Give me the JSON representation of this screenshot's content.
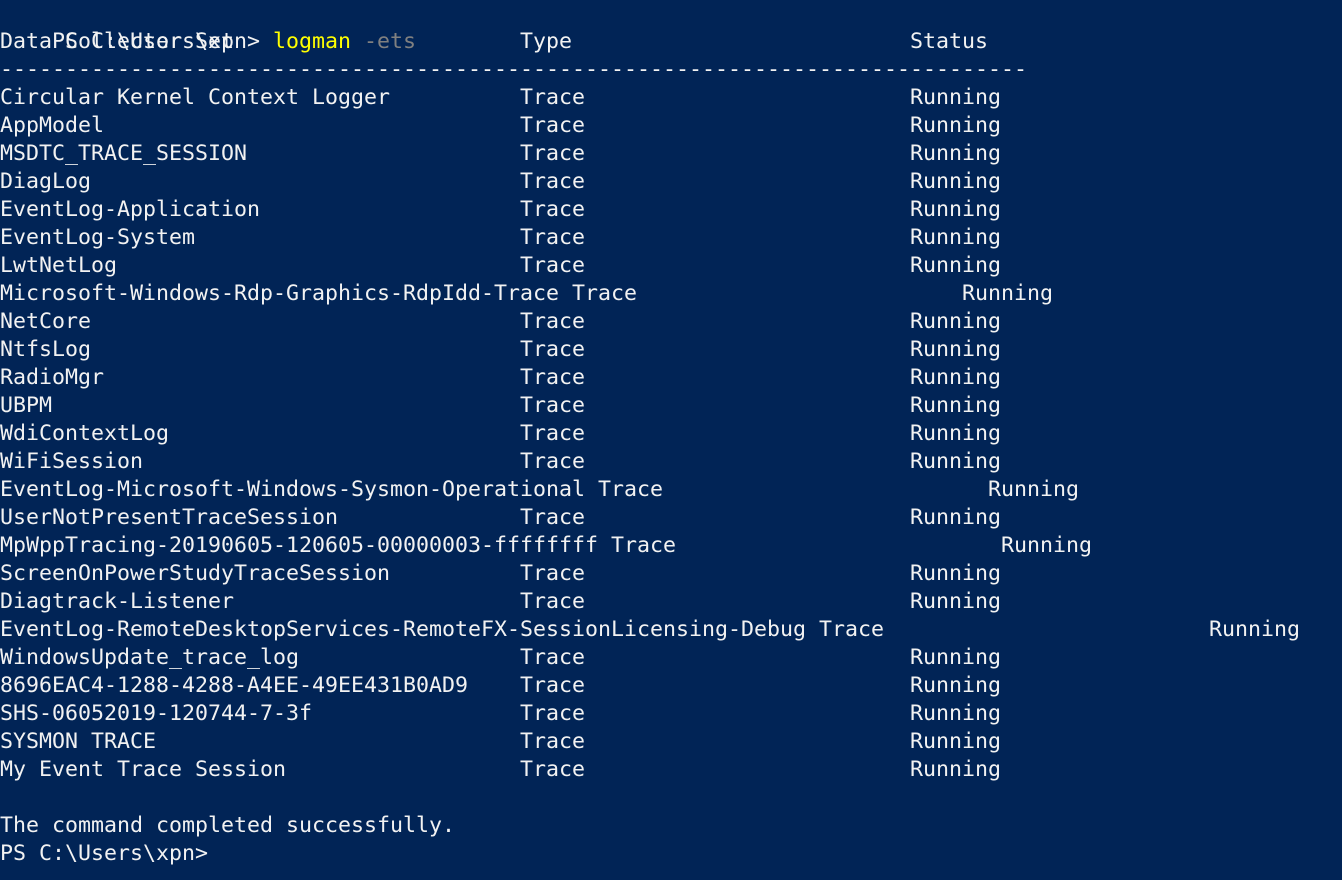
{
  "colors": {
    "background": "#012456",
    "foreground": "#f2f2f2",
    "command": "#ffff00",
    "parameter": "#808080"
  },
  "prompt_top": {
    "prompt": "PS C:\\Users\\xpn> ",
    "command": "logman",
    "parameter": " -ets"
  },
  "headers": {
    "name": "Data Collector Set",
    "type": "Type",
    "status": "Status"
  },
  "separator": "-------------------------------------------------------------------------------",
  "rows": [
    {
      "name": "Circular Kernel Context Logger",
      "type": "Trace",
      "status": "Running"
    },
    {
      "name": "AppModel",
      "type": "Trace",
      "status": "Running"
    },
    {
      "name": "MSDTC_TRACE_SESSION",
      "type": "Trace",
      "status": "Running"
    },
    {
      "name": "DiagLog",
      "type": "Trace",
      "status": "Running"
    },
    {
      "name": "EventLog-Application",
      "type": "Trace",
      "status": "Running"
    },
    {
      "name": "EventLog-System",
      "type": "Trace",
      "status": "Running"
    },
    {
      "name": "LwtNetLog",
      "type": "Trace",
      "status": "Running"
    },
    {
      "name": "Microsoft-Windows-Rdp-Graphics-RdpIdd-Trace",
      "type": "Trace",
      "status": "Running"
    },
    {
      "name": "NetCore",
      "type": "Trace",
      "status": "Running"
    },
    {
      "name": "NtfsLog",
      "type": "Trace",
      "status": "Running"
    },
    {
      "name": "RadioMgr",
      "type": "Trace",
      "status": "Running"
    },
    {
      "name": "UBPM",
      "type": "Trace",
      "status": "Running"
    },
    {
      "name": "WdiContextLog",
      "type": "Trace",
      "status": "Running"
    },
    {
      "name": "WiFiSession",
      "type": "Trace",
      "status": "Running"
    },
    {
      "name": "EventLog-Microsoft-Windows-Sysmon-Operational",
      "type": "Trace",
      "status": "Running"
    },
    {
      "name": "UserNotPresentTraceSession",
      "type": "Trace",
      "status": "Running"
    },
    {
      "name": "MpWppTracing-20190605-120605-00000003-ffffffff",
      "type": "Trace",
      "status": "Running"
    },
    {
      "name": "ScreenOnPowerStudyTraceSession",
      "type": "Trace",
      "status": "Running"
    },
    {
      "name": "Diagtrack-Listener",
      "type": "Trace",
      "status": "Running"
    },
    {
      "name": "EventLog-RemoteDesktopServices-RemoteFX-SessionLicensing-Debug",
      "type": "Trace",
      "status": "Running"
    },
    {
      "name": "WindowsUpdate_trace_log",
      "type": "Trace",
      "status": "Running"
    },
    {
      "name": "8696EAC4-1288-4288-A4EE-49EE431B0AD9",
      "type": "Trace",
      "status": "Running"
    },
    {
      "name": "SHS-06052019-120744-7-3f",
      "type": "Trace",
      "status": "Running"
    },
    {
      "name": "SYSMON TRACE",
      "type": "Trace",
      "status": "Running"
    },
    {
      "name": "My Event Trace Session",
      "type": "Trace",
      "status": "Running"
    }
  ],
  "footer_message": "The command completed successfully.",
  "prompt_bottom": "PS C:\\Users\\xpn>"
}
